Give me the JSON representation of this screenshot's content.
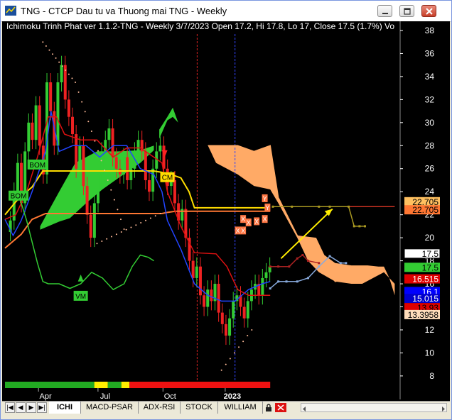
{
  "window": {
    "title": "TNG - CTCP Dau tu va Thuong mai TNG - Weekly"
  },
  "chart": {
    "header": "Ichimoku Trinh Phat ver 1.1.2-TNG - Weekly 3/7/2023 Open 17.2, Hi 17.8, Lo 17, Close 17.5 (1.7%) Vo",
    "months": [
      "Apr",
      "Jul",
      "Oct",
      "2023"
    ]
  },
  "chart_data": {
    "type": "line",
    "y_axis": {
      "range": [
        7.5,
        38.8
      ],
      "ticks": [
        38,
        36,
        34,
        32,
        30,
        28,
        26,
        24,
        22,
        20,
        18,
        16,
        14,
        12,
        10,
        8
      ],
      "position": "right"
    },
    "price_labels": [
      {
        "text": "22.705",
        "value": 23.1,
        "bg": "#ffc060",
        "fg": "#000000"
      },
      {
        "text": "22.705",
        "value": 22.4,
        "bg": "#ff7733",
        "fg": "#000000"
      },
      {
        "text": "17.5",
        "value": 18.6,
        "bg": "#ffffff",
        "fg": "#000000",
        "border": "#000000"
      },
      {
        "text": "17.5",
        "value": 17.4,
        "bg": "#33cc33",
        "fg": "#000000"
      },
      {
        "text": "16.515",
        "value": 16.4,
        "bg": "#e00000",
        "fg": "#ffffff"
      },
      {
        "text": "16.1",
        "value": 15.3,
        "bg": "#0000ff",
        "fg": "#ffffff"
      },
      {
        "text": "15.015",
        "value": 14.7,
        "bg": "#0000cc",
        "fg": "#ffffff"
      },
      {
        "text": "13.93",
        "value": 13.9,
        "bg": "#dd0000",
        "fg": "#000000"
      },
      {
        "text": "13.3958",
        "value": 13.3,
        "bg": "#ffddbb",
        "fg": "#000000"
      }
    ],
    "signals": [
      {
        "text": "BOM",
        "value": 26.3,
        "bar": 12,
        "color": "#33cc33"
      },
      {
        "text": "BOM",
        "value": 23.6,
        "bar": 5,
        "color": "#33cc33"
      },
      {
        "text": "CM",
        "value": 25.2,
        "bar": 60,
        "color": "#ffdd00"
      },
      {
        "text": "VM",
        "value": 14.9,
        "bar": 28,
        "color": "#33cc33"
      }
    ],
    "markers_x": {
      "text": "X",
      "color": "#ff7744"
    },
    "markers_y": {
      "text": "Y",
      "color": "#ff7744"
    },
    "vlines": [
      {
        "bar": 71,
        "color": "#dd2222"
      },
      {
        "bar": 85,
        "color": "#3344ff"
      }
    ],
    "series": [
      {
        "name": "",
        "color": "#ffdd00",
        "points": [
          [
            0,
            22.0
          ],
          [
            5,
            23.4
          ],
          [
            10,
            24.4
          ],
          [
            14,
            25.8
          ],
          [
            20,
            25.8
          ],
          [
            30,
            25.8
          ],
          [
            40,
            25.8
          ],
          [
            55,
            25.8
          ],
          [
            60,
            25.6
          ],
          [
            65,
            25.2
          ],
          [
            68,
            24.0
          ],
          [
            70,
            22.6
          ],
          [
            85,
            22.6
          ],
          [
            95,
            22.6
          ],
          [
            98,
            22.6
          ]
        ]
      },
      {
        "name": "",
        "color": "#ff7733",
        "points": [
          [
            0,
            19.1
          ],
          [
            6,
            20.3
          ],
          [
            10,
            21.6
          ],
          [
            15,
            22.1
          ],
          [
            25,
            22.1
          ],
          [
            35,
            22.1
          ],
          [
            50,
            22.1
          ],
          [
            58,
            22.1
          ],
          [
            60,
            22.2
          ],
          [
            63,
            22.3
          ],
          [
            70,
            22.3
          ],
          [
            86,
            22.3
          ],
          [
            98,
            22.3
          ]
        ]
      },
      {
        "name": "",
        "color": "#2244ff",
        "points": [
          [
            0,
            21.6
          ],
          [
            3,
            20.2
          ],
          [
            6,
            21.5
          ],
          [
            10,
            24.0
          ],
          [
            15,
            27.5
          ],
          [
            17,
            31.0
          ],
          [
            20,
            27.5
          ],
          [
            25,
            28.0
          ],
          [
            30,
            28.0
          ],
          [
            35,
            27.0
          ],
          [
            40,
            28.0
          ],
          [
            45,
            28.0
          ],
          [
            50,
            26.0
          ],
          [
            55,
            25.5
          ],
          [
            58,
            24.0
          ],
          [
            60,
            21.5
          ],
          [
            65,
            19.0
          ],
          [
            70,
            16.0
          ],
          [
            75,
            15.0
          ],
          [
            80,
            14.5
          ],
          [
            85,
            14.5
          ],
          [
            90,
            15.5
          ],
          [
            95,
            16.0
          ],
          [
            98,
            16.2
          ]
        ]
      },
      {
        "name": "",
        "color": "#dd1111",
        "points": [
          [
            0,
            21.6
          ],
          [
            4,
            22.0
          ],
          [
            8,
            24.0
          ],
          [
            12,
            27.0
          ],
          [
            16,
            30.5
          ],
          [
            19,
            30.5
          ],
          [
            22,
            29.0
          ],
          [
            28,
            28.5
          ],
          [
            34,
            28.5
          ],
          [
            40,
            27.0
          ],
          [
            45,
            27.8
          ],
          [
            50,
            27.8
          ],
          [
            55,
            27.0
          ],
          [
            58,
            26.5
          ],
          [
            60,
            24.0
          ],
          [
            65,
            21.0
          ],
          [
            70,
            18.7
          ],
          [
            78,
            18.6
          ],
          [
            82,
            17.5
          ],
          [
            86,
            15.5
          ],
          [
            90,
            15.0
          ],
          [
            95,
            15.0
          ],
          [
            98,
            15.0
          ]
        ]
      },
      {
        "name": "",
        "color": "#33cc33",
        "points": [
          [
            5,
            23.8
          ],
          [
            8,
            21.5
          ],
          [
            12,
            17.8
          ],
          [
            14,
            16.2
          ],
          [
            16,
            16.0
          ],
          [
            20,
            16.0
          ],
          [
            24,
            15.6
          ],
          [
            28,
            16.0
          ],
          [
            32,
            17.0
          ],
          [
            36,
            16.5
          ],
          [
            40,
            15.5
          ],
          [
            44,
            16.0
          ],
          [
            47,
            17.5
          ],
          [
            50,
            18.5
          ],
          [
            53,
            18.3
          ],
          [
            55,
            18.0
          ]
        ]
      },
      {
        "name": "",
        "color": "#ffaa66",
        "points": [
          [
            75,
            28.0
          ],
          [
            86,
            28.0
          ],
          [
            92,
            27.5
          ],
          [
            98,
            28.0
          ],
          [
            101,
            23.5
          ],
          [
            108,
            20.2
          ],
          [
            115,
            18.5
          ],
          [
            122,
            16.2
          ],
          [
            128,
            16.5
          ],
          [
            132,
            16.5
          ],
          [
            136,
            17.0
          ],
          [
            140,
            17.2
          ]
        ]
      },
      {
        "name": "",
        "color": "#88aadd",
        "points": [
          [
            98,
            15.6
          ],
          [
            101,
            16.2
          ],
          [
            104,
            16.2
          ],
          [
            108,
            16.2
          ],
          [
            112,
            16.5
          ],
          [
            116,
            17.5
          ],
          [
            120,
            18.4
          ],
          [
            124,
            17.8
          ],
          [
            126,
            17.8
          ]
        ]
      },
      {
        "name": "",
        "color": "#aa2222",
        "points": [
          [
            98,
            17.5
          ],
          [
            101,
            17.5
          ],
          [
            105,
            17.5
          ],
          [
            108,
            18.2
          ],
          [
            110,
            18.5
          ],
          [
            112,
            18.0
          ],
          [
            116,
            17.8
          ]
        ]
      },
      {
        "name": "",
        "color": "#aa9922",
        "points": [
          [
            99,
            22.7
          ],
          [
            106,
            22.7
          ],
          [
            116,
            22.7
          ],
          [
            120,
            22.7
          ],
          [
            127,
            22.7
          ],
          [
            129,
            21.0
          ],
          [
            131,
            21.0
          ],
          [
            133,
            21.0
          ]
        ]
      },
      {
        "name": "",
        "color": "#cc3322",
        "points": [
          [
            127,
            22.7
          ],
          [
            133,
            22.7
          ],
          [
            144,
            22.7
          ]
        ]
      }
    ],
    "cloud_bull": {
      "color": "#33cc33",
      "top": [
        [
          13,
          21.0
        ],
        [
          20,
          24.0
        ],
        [
          26,
          26.5
        ],
        [
          34,
          27.5
        ],
        [
          42,
          27.5
        ],
        [
          50,
          27.6
        ],
        [
          55,
          28.0
        ]
      ],
      "bottom": [
        [
          13,
          20.7
        ],
        [
          20,
          21.4
        ],
        [
          24,
          21.7
        ],
        [
          30,
          23.0
        ],
        [
          36,
          24.2
        ],
        [
          42,
          25.2
        ],
        [
          50,
          26.5
        ],
        [
          55,
          27.6
        ]
      ]
    },
    "cloud_bull2": {
      "color": "#33cc33",
      "top": [
        [
          57,
          29.4
        ],
        [
          60,
          30.5
        ],
        [
          62,
          31.3
        ],
        [
          64,
          30.0
        ]
      ],
      "bottom": [
        [
          57,
          28.6
        ],
        [
          60,
          30.2
        ],
        [
          62,
          30.5
        ],
        [
          64,
          30.0
        ]
      ]
    },
    "cloud_bear": {
      "color": "#ffaa66",
      "top": [
        [
          75,
          28.0
        ],
        [
          86,
          28.0
        ],
        [
          92,
          27.5
        ],
        [
          98,
          28.0
        ],
        [
          101,
          23.5
        ],
        [
          108,
          20.2
        ],
        [
          115,
          20.0
        ],
        [
          118,
          18.5
        ],
        [
          122,
          17.8
        ],
        [
          128,
          17.6
        ],
        [
          134,
          17.6
        ],
        [
          138,
          17.5
        ],
        [
          140,
          17.5
        ],
        [
          142,
          16.5
        ],
        [
          144,
          15.0
        ]
      ],
      "bottom": [
        [
          75,
          28.0
        ],
        [
          78,
          26.5
        ],
        [
          86,
          25.5
        ],
        [
          92,
          24.5
        ],
        [
          98,
          24.2
        ],
        [
          101,
          23.0
        ],
        [
          108,
          20.0
        ],
        [
          112,
          18.0
        ],
        [
          116,
          17.0
        ],
        [
          122,
          16.2
        ],
        [
          128,
          16.0
        ],
        [
          132,
          16.0
        ],
        [
          136,
          16.5
        ],
        [
          140,
          17.0
        ],
        [
          144,
          16.0
        ]
      ]
    },
    "arrow": {
      "color": "#ffee00",
      "from": [
        102,
        18.2
      ],
      "to": [
        121,
        22.5
      ]
    },
    "bottom_bar": [
      {
        "color": "#22aa22",
        "from_bar": 0,
        "to_bar": 33
      },
      {
        "color": "#ffee00",
        "from_bar": 33,
        "to_bar": 38
      },
      {
        "color": "#22aa22",
        "from_bar": 38,
        "to_bar": 43
      },
      {
        "color": "#ffee00",
        "from_bar": 43,
        "to_bar": 46
      },
      {
        "color": "#ee1111",
        "from_bar": 46,
        "to_bar": 98
      }
    ]
  },
  "tabs": [
    {
      "label": "ICHI",
      "active": true
    },
    {
      "label": "MACD-PSAR",
      "active": false
    },
    {
      "label": "ADX-RSI",
      "active": false
    },
    {
      "label": "STOCK",
      "active": false
    },
    {
      "label": "WILLIAM",
      "active": false
    }
  ],
  "nav_buttons": [
    "|◀",
    "◀",
    "▶",
    "▶|"
  ]
}
